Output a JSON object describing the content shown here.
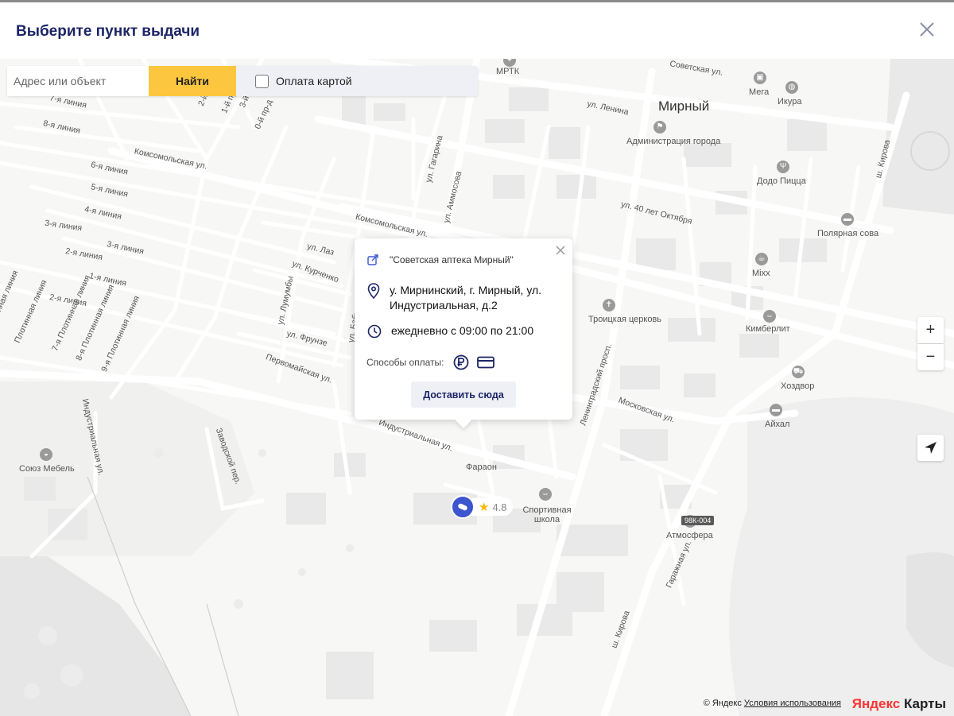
{
  "header": {
    "title": "Выберите пункт выдачи"
  },
  "search": {
    "placeholder": "Адрес или объект",
    "find_label": "Найти",
    "card_filter_label": "Оплата картой"
  },
  "popup": {
    "name": "\"Советская аптека Мирный\"",
    "address": "у. Мирнинский, г. Мирный, ул. Индустриальная, д.2",
    "hours": "ежедневно с 09:00 по 21:00",
    "payment_label": "Способы оплаты:",
    "deliver_label": "Доставить сюда"
  },
  "marker": {
    "rating": "4.8",
    "name": "Фараон"
  },
  "map": {
    "city": "Мирный",
    "streets": [
      "Советская ул.",
      "ул. Ленина",
      "ул. 40 лет Октября",
      "Комсомольская ул.",
      "Комсомольская ул.",
      "ул. Гагарина",
      "ул. Аммосова",
      "ул. Лаз",
      "ул. Курченко",
      "ул. Лумумбы",
      "ул. Бабушкина",
      "ул. Фрунзе",
      "Первомайская ул.",
      "Индустриальная ул.",
      "Московская ул.",
      "Ленинградский просп.",
      "ш. Кирова",
      "ш. Кирова",
      "Гаражная ул.",
      "Заводской пер.",
      "Индустриальная ул.",
      "8-я линия",
      "7-я линия",
      "6-я линия",
      "5-я линия",
      "4-я линия",
      "3-я линия",
      "3-я линия",
      "2-я линия",
      "2-я линия",
      "1-я линия",
      "9-я Плотинная линия",
      "8-я Плотинная линия",
      "7-я Плотинная линия",
      "Плотинная линия",
      "Плотинная линия",
      "1-й пр-д",
      "0-й пр-д",
      "2-й",
      "3-й"
    ],
    "pois": [
      "МРТК",
      "Мега",
      "Икура",
      "Администрация города",
      "Додо Пицца",
      "Полярная сова",
      "Mixx",
      "Троицкая церковь",
      "Кимберлит",
      "Хоздвор",
      "Айхал",
      "Спортивная школа",
      "Атмосфера",
      "Союз Мебель"
    ],
    "road_badge": "98К-004"
  },
  "controls": {
    "zoom_in": "+",
    "zoom_out": "−"
  },
  "footer": {
    "copyright": "© Яндекс",
    "terms": "Условия использования",
    "logo_y": "Яндекс",
    "logo_rest": " Карты"
  }
}
